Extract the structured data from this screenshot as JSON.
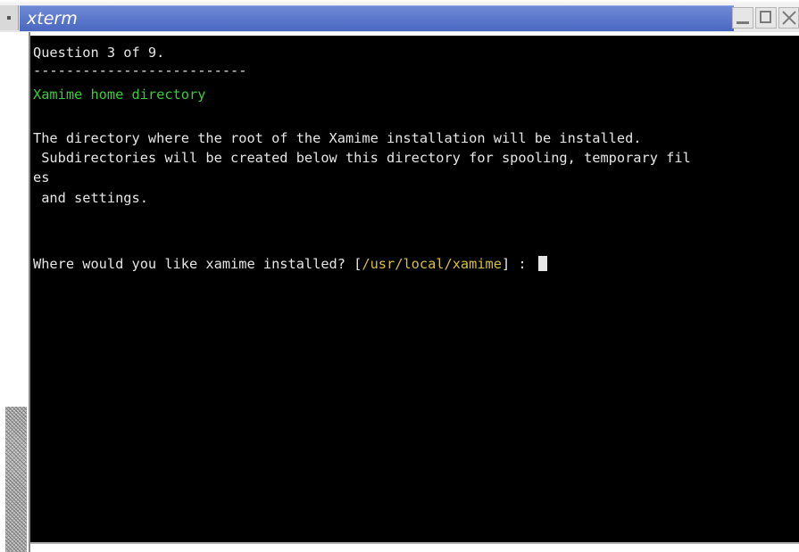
{
  "window": {
    "title": "xterm",
    "buttons": {
      "minimize": "minimize-icon",
      "maximize": "maximize-icon",
      "close": "close-icon"
    }
  },
  "terminal": {
    "question": "Question 3 of 9.",
    "separator": "--------------------------",
    "heading": "Xamime home directory",
    "description_lines": [
      "The directory where the root of the Xamime installation will be installed.",
      " Subdirectories will be created below this directory for spooling, temporary fil",
      "es",
      " and settings."
    ],
    "prompt_text": "Where would you like xamime installed? ",
    "prompt_default_open": "[",
    "prompt_default": "/usr/local/xamime",
    "prompt_default_close": "]",
    "prompt_suffix": " : "
  },
  "colors": {
    "background": "#000000",
    "text": "#e6e6e6",
    "heading": "#3ccb3c",
    "default_value": "#d8c03a",
    "titlebar": "#4a67c2"
  }
}
